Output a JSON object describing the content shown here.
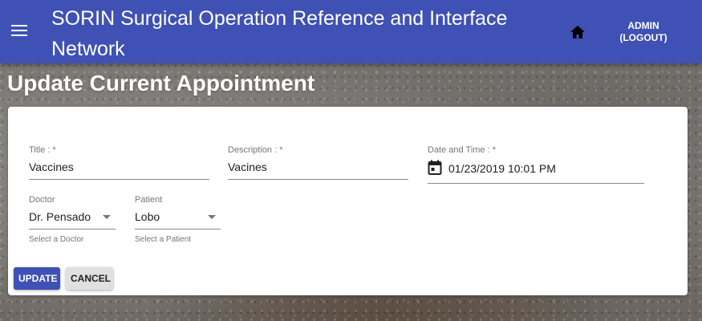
{
  "header": {
    "app_title": "SORIN Surgical Operation Reference and Interface Network",
    "menu_icon": "menu-icon",
    "home_icon": "home-icon",
    "admin_label": "ADMIN",
    "logout_label": "(LOGOUT)",
    "bar_color": "#3f51b5"
  },
  "page": {
    "title": "Update Current Appointment"
  },
  "form": {
    "title": {
      "label": "Title : *",
      "value": "Vaccines"
    },
    "description": {
      "label": "Description : *",
      "value": "Vacines"
    },
    "datetime": {
      "label": "Date and Time : *",
      "value": "01/23/2019 10:01 PM",
      "icon": "calendar-icon"
    },
    "doctor": {
      "label": "Doctor",
      "value": "Dr. Pensado",
      "helper": "Select a Doctor"
    },
    "patient": {
      "label": "Patient",
      "value": "Lobo",
      "helper": "Select a Patient"
    }
  },
  "actions": {
    "update_label": "UPDATE",
    "cancel_label": "CANCEL",
    "primary_color": "#3f51b5"
  }
}
